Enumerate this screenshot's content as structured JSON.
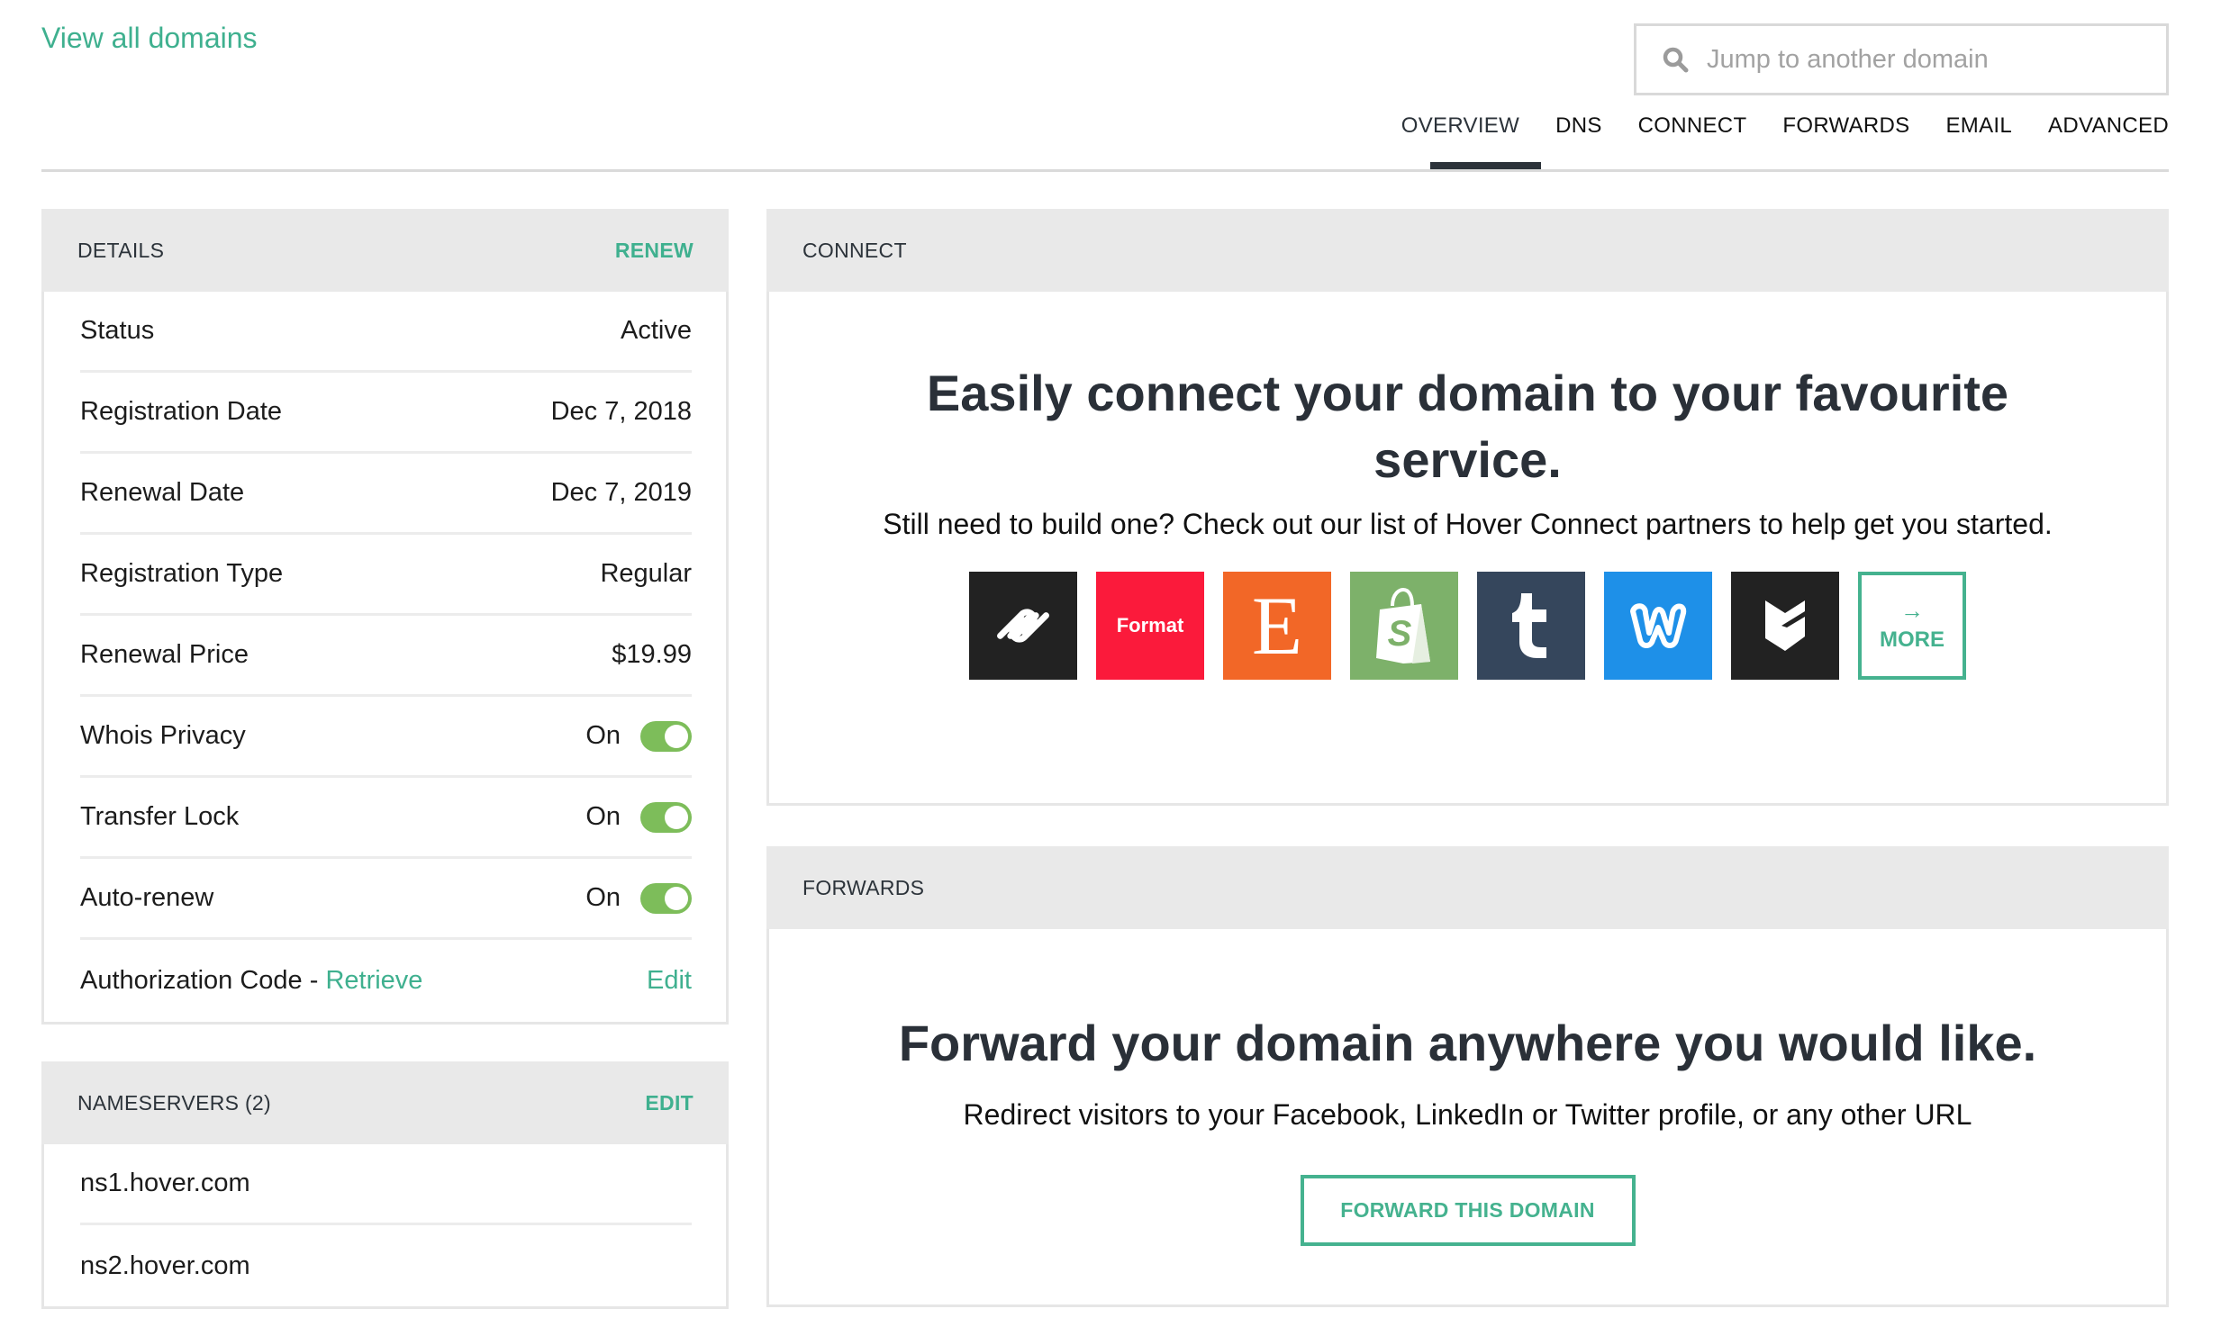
{
  "header": {
    "back_link": "View all domains",
    "search": {
      "placeholder": "Jump to another domain",
      "value": "",
      "icon": "search-icon"
    },
    "tabs": [
      {
        "label": "OVERVIEW",
        "active": true
      },
      {
        "label": "DNS",
        "active": false
      },
      {
        "label": "CONNECT",
        "active": false
      },
      {
        "label": "FORWARDS",
        "active": false
      },
      {
        "label": "EMAIL",
        "active": false
      },
      {
        "label": "ADVANCED",
        "active": false
      }
    ]
  },
  "details": {
    "title": "DETAILS",
    "action": "RENEW",
    "rows": [
      {
        "label": "Status",
        "value": "Active"
      },
      {
        "label": "Registration Date",
        "value": "Dec 7, 2018"
      },
      {
        "label": "Renewal Date",
        "value": "Dec 7, 2019"
      },
      {
        "label": "Registration Type",
        "value": "Regular"
      },
      {
        "label": "Renewal Price",
        "value": "$19.99"
      },
      {
        "label": "Whois Privacy",
        "value": "On",
        "toggle": true
      },
      {
        "label": "Transfer Lock",
        "value": "On",
        "toggle": true
      },
      {
        "label": "Auto-renew",
        "value": "On",
        "toggle": true
      }
    ],
    "auth_code": {
      "label": "Authorization Code - ",
      "link": "Retrieve",
      "action": "Edit"
    }
  },
  "nameservers": {
    "title": "NAMESERVERS (2)",
    "action": "EDIT",
    "items": [
      "ns1.hover.com",
      "ns2.hover.com"
    ]
  },
  "connect": {
    "title": "CONNECT",
    "headline": "Easily connect your domain to your favourite service.",
    "subtext": "Still need to build one? Check out our list of Hover Connect partners to help get you started.",
    "partners": [
      {
        "name": "Squarespace",
        "icon": "squarespace-logo",
        "color": "#222222"
      },
      {
        "name": "Format",
        "label": "Format",
        "color": "#fb1a3b"
      },
      {
        "name": "Etsy",
        "label": "E",
        "color": "#f26727"
      },
      {
        "name": "Shopify",
        "icon": "shopify-bag-logo",
        "color": "#7db16a"
      },
      {
        "name": "Tumblr",
        "icon": "tumblr-logo",
        "color": "#35465c"
      },
      {
        "name": "Weebly",
        "icon": "weebly-logo",
        "color": "#1e90e8"
      },
      {
        "name": "Shield",
        "icon": "shield-logo",
        "color": "#222222"
      }
    ],
    "more_label": "MORE",
    "more_icon": "→"
  },
  "forwards": {
    "title": "FORWARDS",
    "headline": "Forward your domain anywhere you would like.",
    "subtext": "Redirect visitors to your Facebook, LinkedIn or Twitter profile, or any other URL",
    "button": "FORWARD THIS DOMAIN"
  },
  "colors": {
    "accent": "#3fb08f",
    "toggle_on": "#7dbd5a",
    "header_bg": "#e9e9e9",
    "text_dark": "#2c333a"
  }
}
